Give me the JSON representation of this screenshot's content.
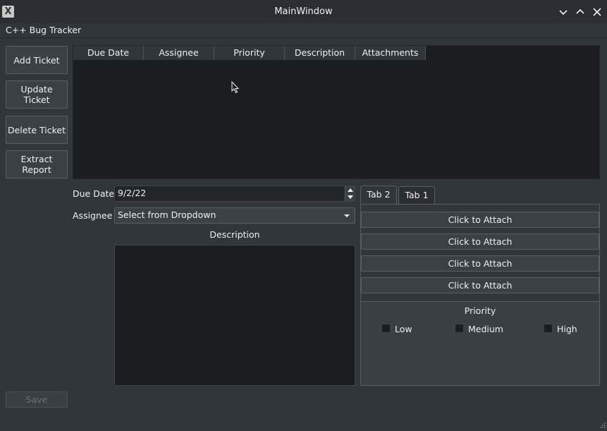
{
  "window": {
    "title": "MainWindow"
  },
  "menubar": {
    "app_label": "C++ Bug Tracker"
  },
  "actions": {
    "add_ticket": "Add Ticket",
    "update_ticket": "Update Ticket",
    "delete_ticket": "Delete Ticket",
    "extract_report": "Extract Report",
    "save": "Save"
  },
  "table": {
    "columns": [
      "Due Date",
      "Assignee",
      "Priority",
      "Description",
      "Attachments"
    ],
    "rows": []
  },
  "form": {
    "due_date_label": "Due Date",
    "due_date_value": "9/2/22",
    "assignee_label": "Assignee",
    "assignee_value": "Select from Dropdown",
    "description_label": "Description",
    "description_value": ""
  },
  "tabs": {
    "items": [
      {
        "label": "Tab 2",
        "active": true
      },
      {
        "label": "Tab 1",
        "active": false
      }
    ],
    "attach_buttons": [
      "Click to Attach",
      "Click to Attach",
      "Click to Attach",
      "Click to Attach"
    ]
  },
  "priority": {
    "title": "Priority",
    "options": [
      {
        "label": "Low",
        "checked": false
      },
      {
        "label": "Medium",
        "checked": false
      },
      {
        "label": "High",
        "checked": false
      }
    ]
  },
  "icons": {
    "app": "app-icon",
    "minimize": "chevron-down-icon",
    "maximize": "chevron-up-icon",
    "close": "close-icon",
    "spin_up": "arrow-up-icon",
    "spin_down": "arrow-down-icon",
    "dropdown": "caret-down-icon",
    "cursor": "mouse-pointer-icon",
    "resize": "resize-grip-icon"
  },
  "colors": {
    "window_bg": "#31363b",
    "view_bg": "#1b1e20",
    "button_bg": "#3b4045",
    "text": "#eff0f1"
  }
}
